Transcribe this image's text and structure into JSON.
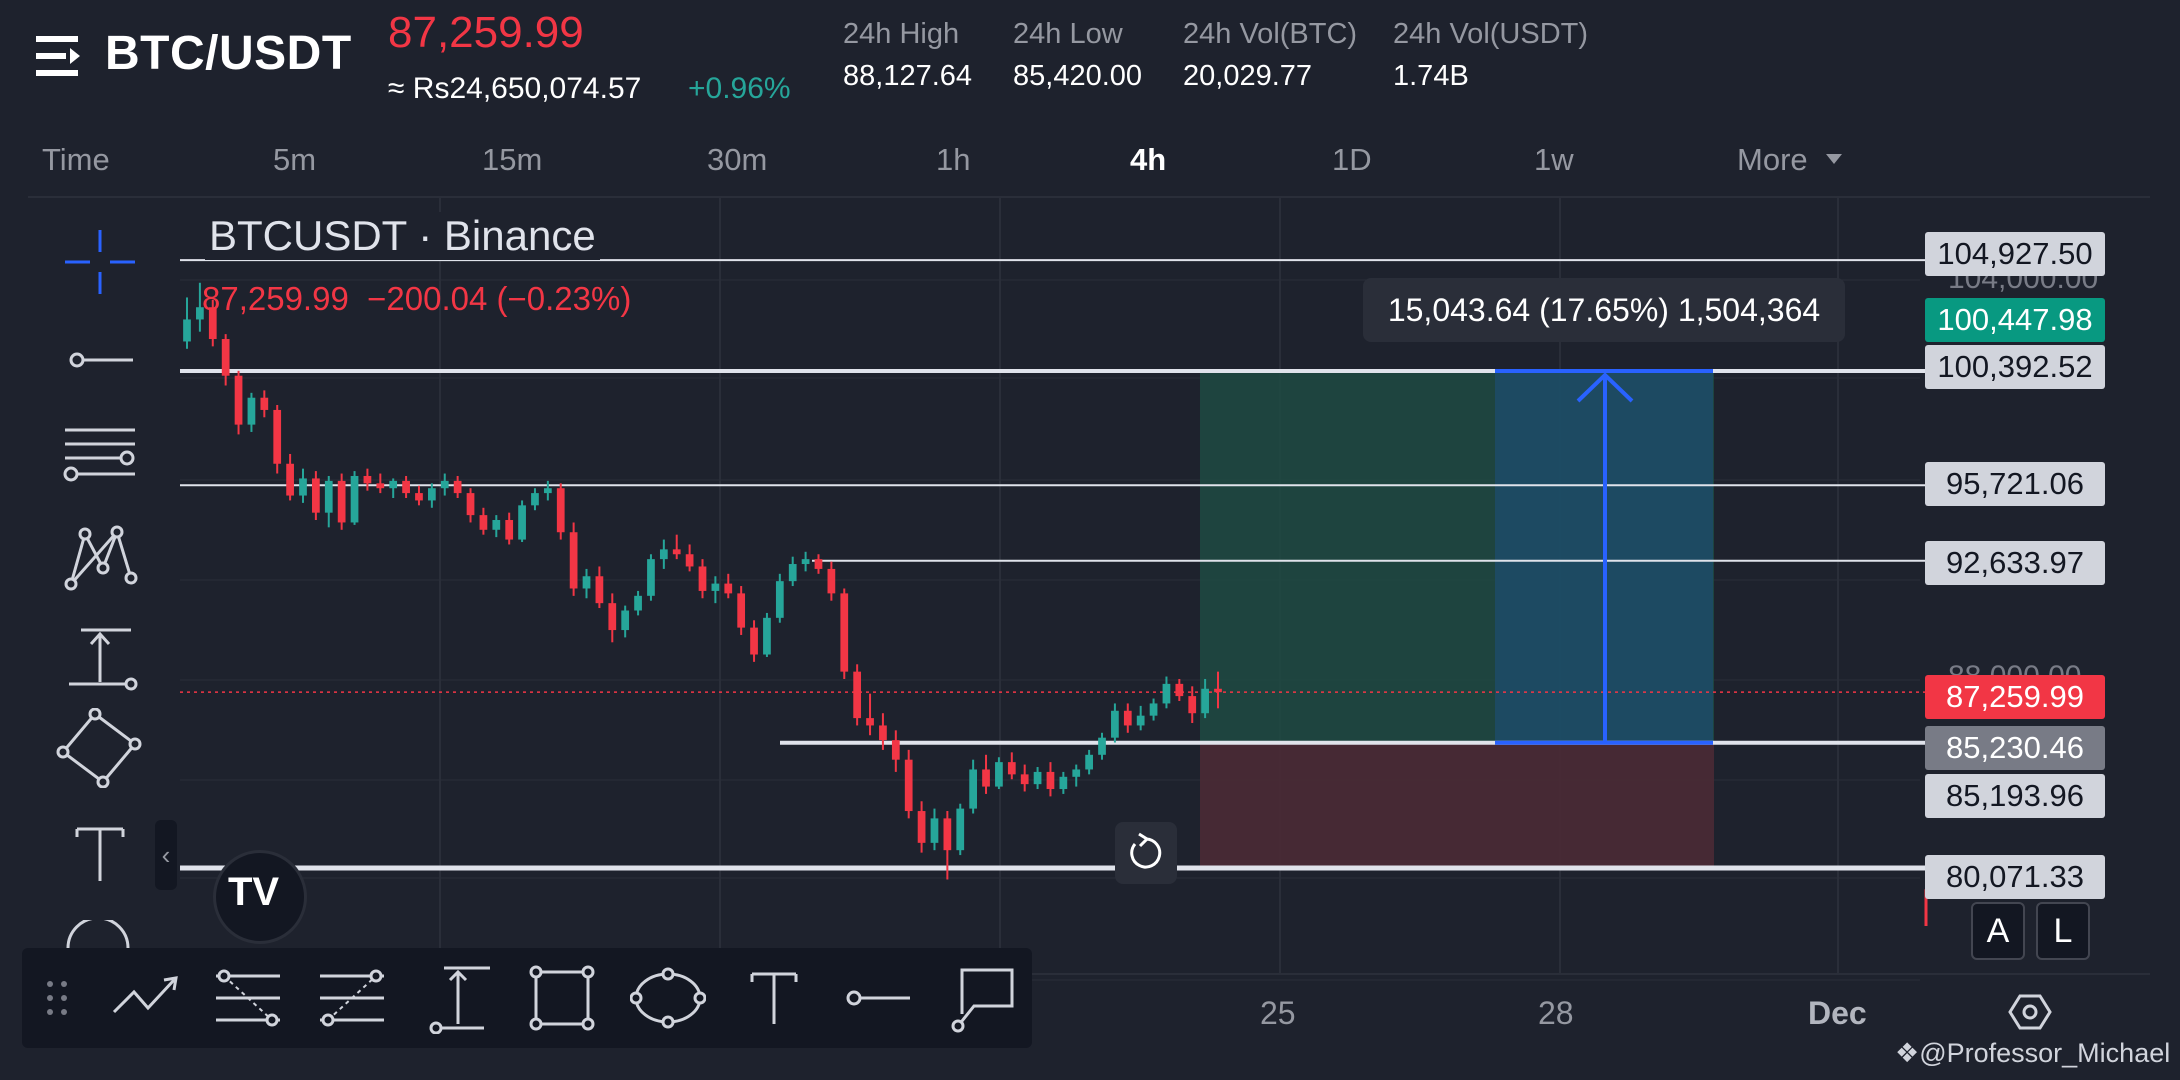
{
  "header": {
    "pair": "BTC/USDT",
    "last_price": "87,259.99",
    "local_price": "≈ Rs24,650,074.57",
    "change_pct": "+0.96%",
    "stats": [
      {
        "label": "24h High",
        "value": "88,127.64"
      },
      {
        "label": "24h Low",
        "value": "85,420.00"
      },
      {
        "label": "24h Vol(BTC)",
        "value": "20,029.77"
      },
      {
        "label": "24h Vol(USDT)",
        "value": "1.74B"
      }
    ]
  },
  "timeframes": {
    "items": [
      "Time",
      "5m",
      "15m",
      "30m",
      "1h",
      "4h",
      "1D",
      "1w",
      "More"
    ],
    "active": "4h"
  },
  "chart": {
    "title": "BTCUSDT · Binance",
    "ohlc_price": "87,259.99",
    "ohlc_change": "−200.04 (−0.23%)",
    "measure_text": "15,043.64 (17.65%) 1,504,364",
    "price_labels": {
      "l104927": "104,927.50",
      "l100447": "100,447.98",
      "l100392": "100,392.52",
      "l95721": "95,721.06",
      "l92633": "92,633.97",
      "l87259": "87,259.99",
      "l85230": "85,230.46",
      "l85193": "85,193.96",
      "l80071": "80,071.33"
    },
    "ghost_labels": {
      "g104000": "104,000.00",
      "g88000": "88,000.00"
    },
    "dates": [
      "25",
      "28",
      "Dec"
    ],
    "alert_buttons": [
      "A",
      "L"
    ],
    "colors": {
      "up": "#26a69a",
      "down": "#f23645",
      "profit_zone": "#1f4a43",
      "loss_zone": "#4a2a35",
      "measure": "#2962ff"
    }
  },
  "chart_data": {
    "type": "candlestick",
    "interval": "4h",
    "candles": [
      {
        "o": 101600,
        "h": 103400,
        "l": 101300,
        "c": 102500
      },
      {
        "o": 102500,
        "h": 104000,
        "l": 102000,
        "c": 103000
      },
      {
        "o": 103000,
        "h": 103300,
        "l": 101400,
        "c": 101700
      },
      {
        "o": 101700,
        "h": 101900,
        "l": 99800,
        "c": 100200
      },
      {
        "o": 100200,
        "h": 100400,
        "l": 97800,
        "c": 98200
      },
      {
        "o": 98200,
        "h": 99500,
        "l": 97900,
        "c": 99300
      },
      {
        "o": 99300,
        "h": 99600,
        "l": 98500,
        "c": 98800
      },
      {
        "o": 98800,
        "h": 99000,
        "l": 96200,
        "c": 96600
      },
      {
        "o": 96600,
        "h": 97000,
        "l": 95100,
        "c": 95300
      },
      {
        "o": 95300,
        "h": 96400,
        "l": 95000,
        "c": 96000
      },
      {
        "o": 96000,
        "h": 96300,
        "l": 94300,
        "c": 94600
      },
      {
        "o": 94600,
        "h": 96100,
        "l": 94000,
        "c": 95900
      },
      {
        "o": 95900,
        "h": 96200,
        "l": 93900,
        "c": 94200
      },
      {
        "o": 94200,
        "h": 96300,
        "l": 94100,
        "c": 96100
      },
      {
        "o": 96100,
        "h": 96400,
        "l": 95500,
        "c": 95800
      },
      {
        "o": 95800,
        "h": 96200,
        "l": 95400,
        "c": 95600
      },
      {
        "o": 95600,
        "h": 96000,
        "l": 95200,
        "c": 95900
      },
      {
        "o": 95900,
        "h": 96100,
        "l": 95200,
        "c": 95400
      },
      {
        "o": 95400,
        "h": 95700,
        "l": 94900,
        "c": 95100
      },
      {
        "o": 95100,
        "h": 95800,
        "l": 94800,
        "c": 95600
      },
      {
        "o": 95600,
        "h": 96200,
        "l": 95300,
        "c": 95900
      },
      {
        "o": 95900,
        "h": 96100,
        "l": 95200,
        "c": 95400
      },
      {
        "o": 95400,
        "h": 95600,
        "l": 94200,
        "c": 94500
      },
      {
        "o": 94500,
        "h": 94800,
        "l": 93700,
        "c": 93900
      },
      {
        "o": 93900,
        "h": 94500,
        "l": 93600,
        "c": 94300
      },
      {
        "o": 94300,
        "h": 94600,
        "l": 93300,
        "c": 93500
      },
      {
        "o": 93500,
        "h": 95100,
        "l": 93400,
        "c": 94900
      },
      {
        "o": 94900,
        "h": 95600,
        "l": 94700,
        "c": 95400
      },
      {
        "o": 95400,
        "h": 95900,
        "l": 95100,
        "c": 95600
      },
      {
        "o": 95600,
        "h": 95800,
        "l": 93500,
        "c": 93800
      },
      {
        "o": 93800,
        "h": 94200,
        "l": 91200,
        "c": 91500
      },
      {
        "o": 91500,
        "h": 92300,
        "l": 91100,
        "c": 92000
      },
      {
        "o": 92000,
        "h": 92400,
        "l": 90700,
        "c": 90900
      },
      {
        "o": 90900,
        "h": 91300,
        "l": 89300,
        "c": 89800
      },
      {
        "o": 89800,
        "h": 90800,
        "l": 89500,
        "c": 90600
      },
      {
        "o": 90600,
        "h": 91400,
        "l": 90400,
        "c": 91200
      },
      {
        "o": 91200,
        "h": 92900,
        "l": 91000,
        "c": 92700
      },
      {
        "o": 92700,
        "h": 93500,
        "l": 92300,
        "c": 93100
      },
      {
        "o": 93100,
        "h": 93700,
        "l": 92700,
        "c": 92900
      },
      {
        "o": 92900,
        "h": 93300,
        "l": 92200,
        "c": 92400
      },
      {
        "o": 92400,
        "h": 92700,
        "l": 91100,
        "c": 91400
      },
      {
        "o": 91400,
        "h": 92000,
        "l": 90900,
        "c": 91700
      },
      {
        "o": 91700,
        "h": 92100,
        "l": 91100,
        "c": 91300
      },
      {
        "o": 91300,
        "h": 91600,
        "l": 89600,
        "c": 89900
      },
      {
        "o": 89900,
        "h": 90200,
        "l": 88500,
        "c": 88800
      },
      {
        "o": 88800,
        "h": 90500,
        "l": 88700,
        "c": 90300
      },
      {
        "o": 90300,
        "h": 92100,
        "l": 90100,
        "c": 91800
      },
      {
        "o": 91800,
        "h": 92800,
        "l": 91600,
        "c": 92500
      },
      {
        "o": 92500,
        "h": 93000,
        "l": 92200,
        "c": 92700
      },
      {
        "o": 92700,
        "h": 92900,
        "l": 92100,
        "c": 92300
      },
      {
        "o": 92300,
        "h": 92600,
        "l": 91000,
        "c": 91300
      },
      {
        "o": 91300,
        "h": 91500,
        "l": 87800,
        "c": 88100
      },
      {
        "o": 88100,
        "h": 88400,
        "l": 85900,
        "c": 86200
      },
      {
        "o": 86200,
        "h": 87200,
        "l": 85500,
        "c": 85900
      },
      {
        "o": 85900,
        "h": 86400,
        "l": 84900,
        "c": 85300
      },
      {
        "o": 85300,
        "h": 85700,
        "l": 84000,
        "c": 84500
      },
      {
        "o": 84500,
        "h": 84900,
        "l": 82100,
        "c": 82400
      },
      {
        "o": 82400,
        "h": 82800,
        "l": 80700,
        "c": 81100
      },
      {
        "o": 81100,
        "h": 82500,
        "l": 80800,
        "c": 82100
      },
      {
        "o": 82100,
        "h": 82400,
        "l": 79600,
        "c": 80800
      },
      {
        "o": 80800,
        "h": 82700,
        "l": 80600,
        "c": 82500
      },
      {
        "o": 82500,
        "h": 84500,
        "l": 82300,
        "c": 84100
      },
      {
        "o": 84100,
        "h": 84700,
        "l": 83100,
        "c": 83400
      },
      {
        "o": 83400,
        "h": 84600,
        "l": 83300,
        "c": 84400
      },
      {
        "o": 84400,
        "h": 84800,
        "l": 83700,
        "c": 83900
      },
      {
        "o": 83900,
        "h": 84300,
        "l": 83200,
        "c": 83500
      },
      {
        "o": 83500,
        "h": 84200,
        "l": 83300,
        "c": 84000
      },
      {
        "o": 84000,
        "h": 84400,
        "l": 83000,
        "c": 83300
      },
      {
        "o": 83300,
        "h": 84000,
        "l": 83100,
        "c": 83800
      },
      {
        "o": 83800,
        "h": 84300,
        "l": 83400,
        "c": 84100
      },
      {
        "o": 84100,
        "h": 84900,
        "l": 83900,
        "c": 84700
      },
      {
        "o": 84700,
        "h": 85600,
        "l": 84500,
        "c": 85400
      },
      {
        "o": 85400,
        "h": 86800,
        "l": 85200,
        "c": 86500
      },
      {
        "o": 86500,
        "h": 86800,
        "l": 85600,
        "c": 85900
      },
      {
        "o": 85900,
        "h": 86700,
        "l": 85700,
        "c": 86300
      },
      {
        "o": 86300,
        "h": 87000,
        "l": 86100,
        "c": 86800
      },
      {
        "o": 86800,
        "h": 87900,
        "l": 86600,
        "c": 87600
      },
      {
        "o": 87600,
        "h": 87800,
        "l": 86900,
        "c": 87100
      },
      {
        "o": 87100,
        "h": 87500,
        "l": 86000,
        "c": 86400
      },
      {
        "o": 86400,
        "h": 87800,
        "l": 86200,
        "c": 87400
      },
      {
        "o": 87400,
        "h": 88100,
        "l": 86600,
        "c": 87260
      }
    ]
  },
  "watermark": "@Professor_Michael",
  "logo_text": "TV"
}
